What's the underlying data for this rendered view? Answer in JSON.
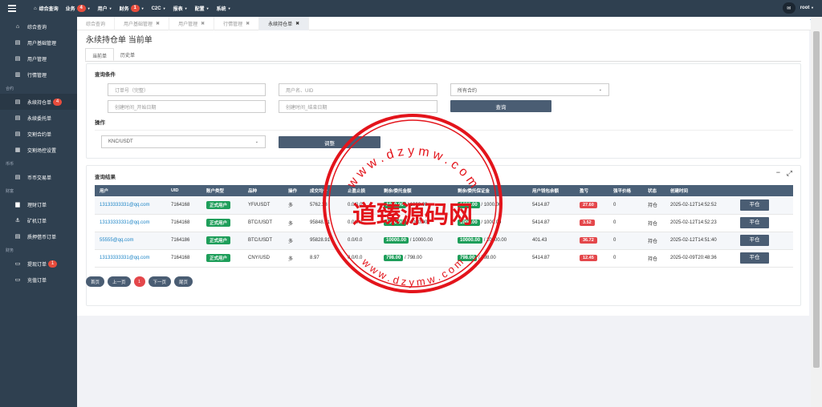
{
  "topbar": {
    "menu": [
      {
        "label": "综合查询",
        "home": true
      },
      {
        "label": "业务",
        "badge": "4"
      },
      {
        "label": "用户"
      },
      {
        "label": "财务",
        "badge": "1"
      },
      {
        "label": "C2C"
      },
      {
        "label": "报表"
      },
      {
        "label": "配置"
      },
      {
        "label": "系统"
      }
    ],
    "user": "root"
  },
  "sidebar": {
    "items": [
      {
        "label": "综合查询",
        "icon": "home-icon",
        "glyph": "⌂"
      },
      {
        "label": "用户基础管理",
        "icon": "document-icon",
        "glyph": "▤"
      },
      {
        "label": "用户管理",
        "icon": "document-icon",
        "glyph": "▤"
      },
      {
        "label": "行情管理",
        "icon": "chart-icon",
        "glyph": "▥"
      }
    ],
    "group_contract": "合约",
    "contract_items": [
      {
        "label": "永续持仓单",
        "badge": "4",
        "icon": "document-icon",
        "glyph": "▤"
      },
      {
        "label": "永续委托单",
        "icon": "document-icon",
        "glyph": "▤"
      },
      {
        "label": "交割合约单",
        "icon": "document-icon",
        "glyph": "▤"
      },
      {
        "label": "交割场控设置",
        "icon": "columns-icon",
        "glyph": "▦"
      }
    ],
    "group_coin": "币币",
    "coin_items": [
      {
        "label": "币币交易单",
        "icon": "document-icon",
        "glyph": "▤"
      }
    ],
    "group_wealth": "财富",
    "wealth_items": [
      {
        "label": "理财订单",
        "icon": "folder-icon",
        "glyph": "▆"
      },
      {
        "label": "矿机订单",
        "icon": "anchor-icon",
        "glyph": "⚓"
      },
      {
        "label": "质押借币订单",
        "icon": "document-icon",
        "glyph": "▤"
      }
    ],
    "group_finance": "财务",
    "finance_items": [
      {
        "label": "提现订单",
        "badge": "1",
        "icon": "card-icon",
        "glyph": "▭"
      },
      {
        "label": "充值订单",
        "icon": "card-icon",
        "glyph": "▭"
      }
    ]
  },
  "tabs": [
    {
      "label": "综合查询",
      "closable": false
    },
    {
      "label": "用户基础管理",
      "closable": true
    },
    {
      "label": "用户管理",
      "closable": true
    },
    {
      "label": "行情管理",
      "closable": true
    },
    {
      "label": "永续持仓单",
      "closable": true,
      "active": true
    }
  ],
  "page": {
    "title": "永续持仓单 当前单",
    "subtabs": [
      "当前单",
      "历史单"
    ]
  },
  "query": {
    "title": "查询条件",
    "order_placeholder": "订单号（完整）",
    "user_placeholder": "用户名、UID",
    "contract_select": "所有合约",
    "start_placeholder": "创建时间_开始日期",
    "end_placeholder": "创建时间_结束日期",
    "search_label": "查询",
    "op_title": "操作",
    "op_select": "KNC/USDT",
    "adjust_label": "调整"
  },
  "results": {
    "title": "查询结果",
    "columns": [
      "用户",
      "UID",
      "账户类型",
      "品种",
      "操作",
      "成交均价",
      "止盈止损",
      "剩余/委托金额",
      "剩余/委托保证金",
      "用户钱包余额",
      "盈亏",
      "强平价格",
      "状态",
      "创建时间",
      ""
    ],
    "rows": [
      {
        "user": "13133333331@qq.com",
        "uid": "7164168",
        "type": "正式用户",
        "symbol": "YFI/USDT",
        "dir": "多",
        "price": "5762.38",
        "tpsl": "0.0/0.0",
        "amount_remain": "1000.00",
        "amount_total": " / 1000.00",
        "margin_remain": "1000.00",
        "margin_total": " / 1000.00",
        "wallet": "5414.87",
        "pnl": "27.60",
        "liq": "0",
        "status": "持仓",
        "time": "2025-02-12T14:52:52",
        "action": "平仓"
      },
      {
        "user": "13133333331@qq.com",
        "uid": "7164168",
        "type": "正式用户",
        "symbol": "BTC/USDT",
        "dir": "多",
        "price": "95848.91",
        "tpsl": "0.0/0.0",
        "amount_remain": "1000.00",
        "amount_total": " / 1000.00",
        "margin_remain": "1000.00",
        "margin_total": " / 1000.00",
        "wallet": "5414.87",
        "pnl": "3.52",
        "liq": "0",
        "status": "持仓",
        "time": "2025-02-12T14:52:23",
        "action": "平仓"
      },
      {
        "user": "55555@qq.com",
        "uid": "7164186",
        "type": "正式用户",
        "symbol": "BTC/USDT",
        "dir": "多",
        "price": "95828.91",
        "tpsl": "0.0/0.0",
        "amount_remain": "10000.00",
        "amount_total": " / 10000.00",
        "margin_remain": "10000.00",
        "margin_total": " / 10000.00",
        "wallet": "401.43",
        "pnl": "36.72",
        "liq": "0",
        "status": "持仓",
        "time": "2025-02-12T14:51:40",
        "action": "平仓"
      },
      {
        "user": "13133333331@qq.com",
        "uid": "7164168",
        "type": "正式用户",
        "symbol": "CNY/USD",
        "dir": "多",
        "price": "8.97",
        "tpsl": "0.0/0.0",
        "amount_remain": "798.00",
        "amount_total": " / 798.00",
        "margin_remain": "798.00",
        "margin_total": " / 798.00",
        "wallet": "5414.87",
        "pnl": "12.45",
        "liq": "0",
        "status": "持仓",
        "time": "2025-02-09T20:48:36",
        "action": "平仓"
      }
    ],
    "pager": {
      "first": "首页",
      "prev": "上一页",
      "current": "1",
      "next": "下一页",
      "last": "尾页"
    }
  },
  "watermark": {
    "top_text": "w w w . d z y m w . c o m",
    "center_text": "道臻源码网",
    "bottom_text": "w w w . d z y m w . c o m",
    "color": "#e3141b"
  }
}
